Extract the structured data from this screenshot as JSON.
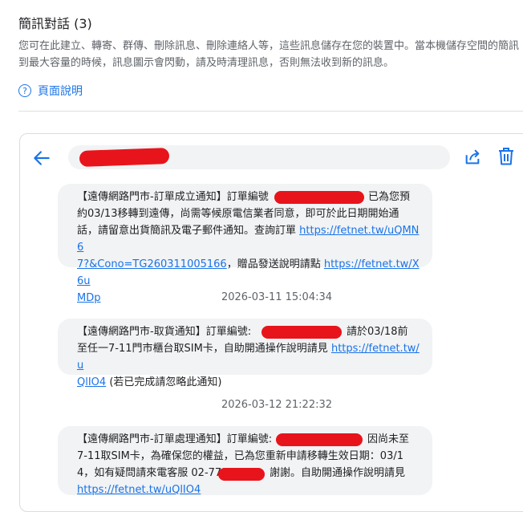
{
  "header": {
    "title": "簡訊對話 (3)",
    "description_line1": "您可在此建立、轉寄、群傳、刪除訊息、刪除連絡人等，這些訊息儲存在您的裝置中。當本機儲存空間的簡訊",
    "description_line2": "到最大容量的時候，訊息圖示會閃動，請及時清理訊息，否則無法收到新的訊息。",
    "help_label": "頁面說明"
  },
  "conversation": {
    "icons": {
      "back": "back-arrow-icon",
      "share": "share-icon",
      "delete": "trash-icon",
      "help": "help-circle-icon"
    },
    "colors": {
      "accent": "#1a73e8",
      "bubble": "#f1f3f4",
      "redaction": "#e8141c"
    },
    "messages": [
      {
        "timestamp": "",
        "line1_pre": "【遠傳網路門市-訂單成立通知】訂單編號",
        "line1_post": "已為您預",
        "line2": "約03/13移轉到遠傳，尚需等候原電信業者同意，即可於此日期開始通",
        "line3_pre": "話，請留意出貨簡訊及電子郵件通知。查詢訂單 ",
        "link1_a": "https://fetnet.tw/uQMN6",
        "link1_b": "7?&Cono=TG260311005166",
        "line4_mid": "，贈品發送說明請點 ",
        "link2_a": "https://fetnet.tw/X6u",
        "link2_b": "MDp"
      },
      {
        "timestamp": "2026-03-11 15:04:34",
        "line1_pre": "【遠傳網路門市-取貨通知】訂單編號:",
        "line1_post": "請於03/18前",
        "line2_pre": "至任一7-11門市櫃台取SIM卡，自助開通操作說明請見 ",
        "link_a": "https://fetnet.tw/u",
        "link_b": "QlIO4",
        "line3_post": " (若已完成請忽略此通知)"
      },
      {
        "timestamp": "2026-03-12 21:22:32",
        "line1_pre": "【遠傳網路門市-訂單處理通知】訂單編號:",
        "line1_post": "因尚未至",
        "line2": "7-11取SIM卡，為確保您的權益，已為您重新申請移轉生效日期：03/1",
        "line3_pre": "4，如有疑問請來電客服 02-7715",
        "line3_post": "謝謝。自助開通操作說明請見",
        "link": "https://fetnet.tw/uQlIO4"
      }
    ]
  }
}
